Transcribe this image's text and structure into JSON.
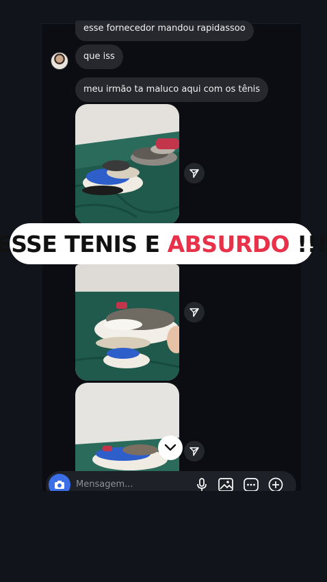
{
  "messages": [
    {
      "text": "esse fornecedor mandou rapidassoo"
    },
    {
      "text": "que iss"
    },
    {
      "text": "meu irmão ta  maluco aqui com os tênis"
    }
  ],
  "banner": {
    "part1": "ESSE TENIS E ",
    "part2": "ABSURDO",
    "part3": " !!!"
  },
  "composer": {
    "placeholder": "Mensagem..."
  },
  "colors": {
    "banner_accent": "#e8324a",
    "camera_button": "#3a6fe8",
    "bubble": "#26282d",
    "background": "#0b0d12"
  },
  "icons": [
    "camera-icon",
    "microphone-icon",
    "gallery-icon",
    "sticker-icon",
    "plus-icon",
    "share-icon",
    "chevron-down-icon"
  ]
}
